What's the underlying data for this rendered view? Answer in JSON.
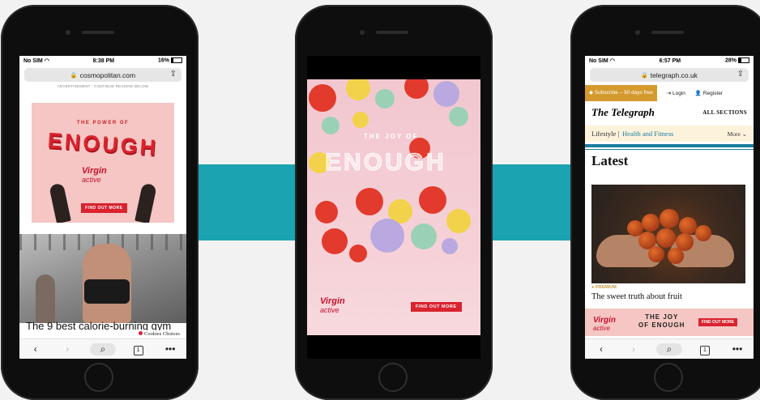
{
  "colors": {
    "band": "#1ba3b1",
    "virgin_red": "#d9232f",
    "telegraph_blue": "#1a7da0",
    "subscribe_gold": "#d49a2e"
  },
  "phone1": {
    "status": {
      "carrier": "No SIM",
      "wifi_icon": "wifi-icon",
      "time": "8:38 PM",
      "battery": "16%",
      "battery_level": 0.16
    },
    "url": "cosmopolitan.com",
    "ad_note": "ADVERTISEMENT · CONTINUE READING BELOW",
    "ad": {
      "tagline": "THE POWER OF",
      "headline": "ENOUGH",
      "brand_top": "Virgin",
      "brand_bottom": "active",
      "cta": "FIND OUT MORE"
    },
    "article_title": "The 9 best calorie-burning gym",
    "cookies": "Cookies Choices",
    "toolbar": {
      "tabs_count": "1"
    }
  },
  "phone2": {
    "ad": {
      "tagline": "THE JOY OF",
      "headline": "ENOUGH",
      "brand_top": "Virgin",
      "brand_bottom": "active",
      "cta": "FIND OUT MORE"
    }
  },
  "phone3": {
    "status": {
      "carrier": "No SIM",
      "wifi_icon": "wifi-icon",
      "time": "6:57 PM",
      "battery": "28%",
      "battery_level": 0.28
    },
    "url": "telegraph.co.uk",
    "subscribe": "◆ Subscribe – 30 days free",
    "login": "Login",
    "register": "Register",
    "logo": "The Telegraph",
    "all_sections": "ALL SECTIONS",
    "section": "Lifestyle",
    "subsection": "Health and Fitness",
    "more": "More ⌄",
    "latest": "Latest",
    "premium": "● PREMIUM",
    "article_title": "The sweet truth about fruit",
    "ad": {
      "brand_top": "Virgin",
      "brand_bottom": "active",
      "line1": "THE JOY",
      "line2": "OF ENOUGH",
      "cta": "FIND OUT MORE"
    },
    "toolbar": {
      "tabs_count": "1"
    }
  }
}
